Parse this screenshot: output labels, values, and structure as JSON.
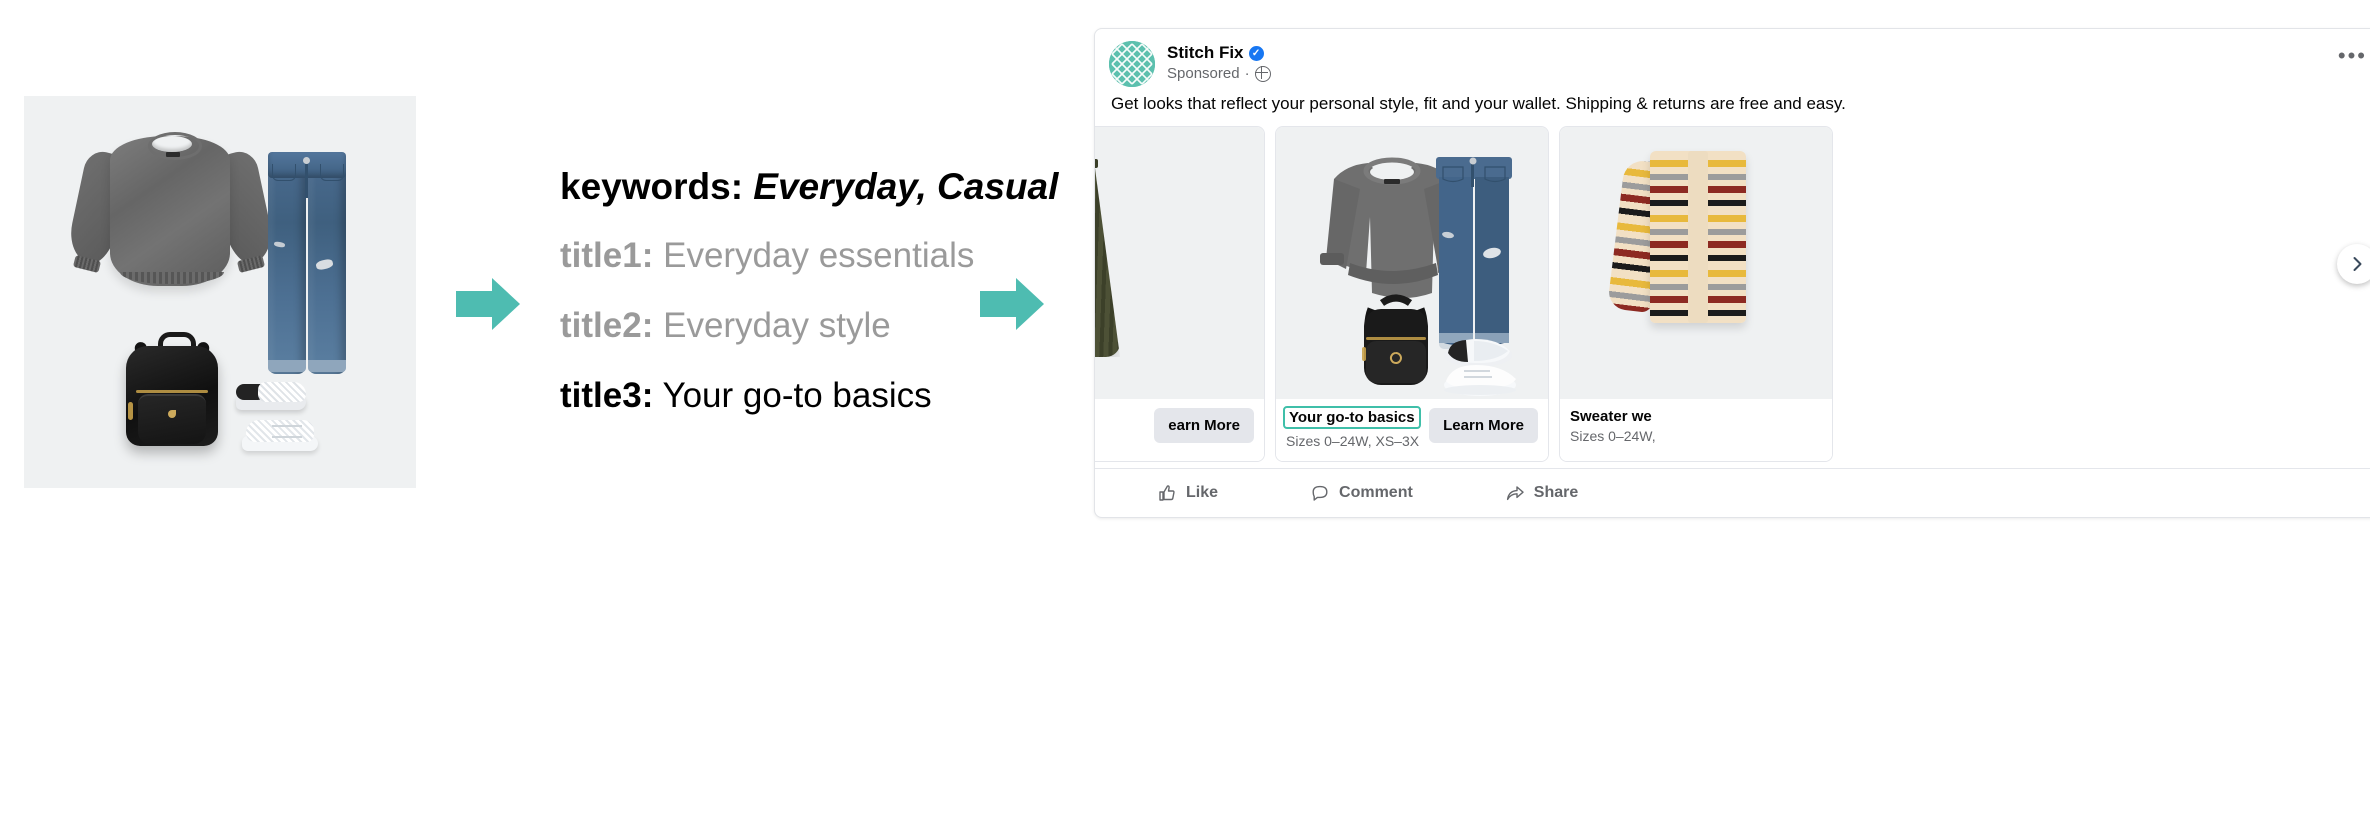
{
  "source_image": {
    "alt": "outfit flat-lay: gray crewneck sweater, blue distressed skinny jeans, black backpack, white slip-on shoe and white sneaker on light gray background",
    "background": "#eff1f2"
  },
  "titles": {
    "keywords_label": "keywords:",
    "keywords_value": "Everyday, Casual",
    "rows": [
      {
        "label": "title1:",
        "value": "Everyday essentials",
        "state": "dim"
      },
      {
        "label": "title2:",
        "value": "Everyday style",
        "state": "dim"
      },
      {
        "label": "title3:",
        "value": "Your go-to basics",
        "state": "selected"
      }
    ]
  },
  "arrows": {
    "color": "#4ebcb1",
    "first_name": "flow-arrow-1",
    "second_name": "flow-arrow-2"
  },
  "ad": {
    "advertiser": "Stitch Fix",
    "verified_glyph": "✓",
    "sponsored_label": "Sponsored",
    "separator": "·",
    "more_glyph": "•••",
    "body_text": "Get looks that reflect your personal style, fit and your wallet. Shipping & returns are free and easy.",
    "avatar_color": "#5cc0ae",
    "highlight_color": "#3fbfa9",
    "carousel": {
      "prev_label": "‹",
      "next_label": "›",
      "cards": [
        {
          "title": "",
          "subtitle": "",
          "cta": "earn More",
          "media": "olive-pleated-skirt",
          "highlighted": false
        },
        {
          "title": "Your go-to basics",
          "subtitle": "Sizes 0–24W, XS–3X",
          "cta": "Learn More",
          "media": "gray-sweater-jeans-backpack-shoes",
          "highlighted": true
        },
        {
          "title": "Sweater we",
          "subtitle": "Sizes 0–24W,",
          "cta": "",
          "media": "striped-cardigan",
          "highlighted": false
        }
      ]
    },
    "actions": [
      {
        "label": "Like",
        "icon": "thumbs-up-icon"
      },
      {
        "label": "Comment",
        "icon": "comment-bubble-icon"
      },
      {
        "label": "Share",
        "icon": "share-arrow-icon"
      }
    ]
  }
}
